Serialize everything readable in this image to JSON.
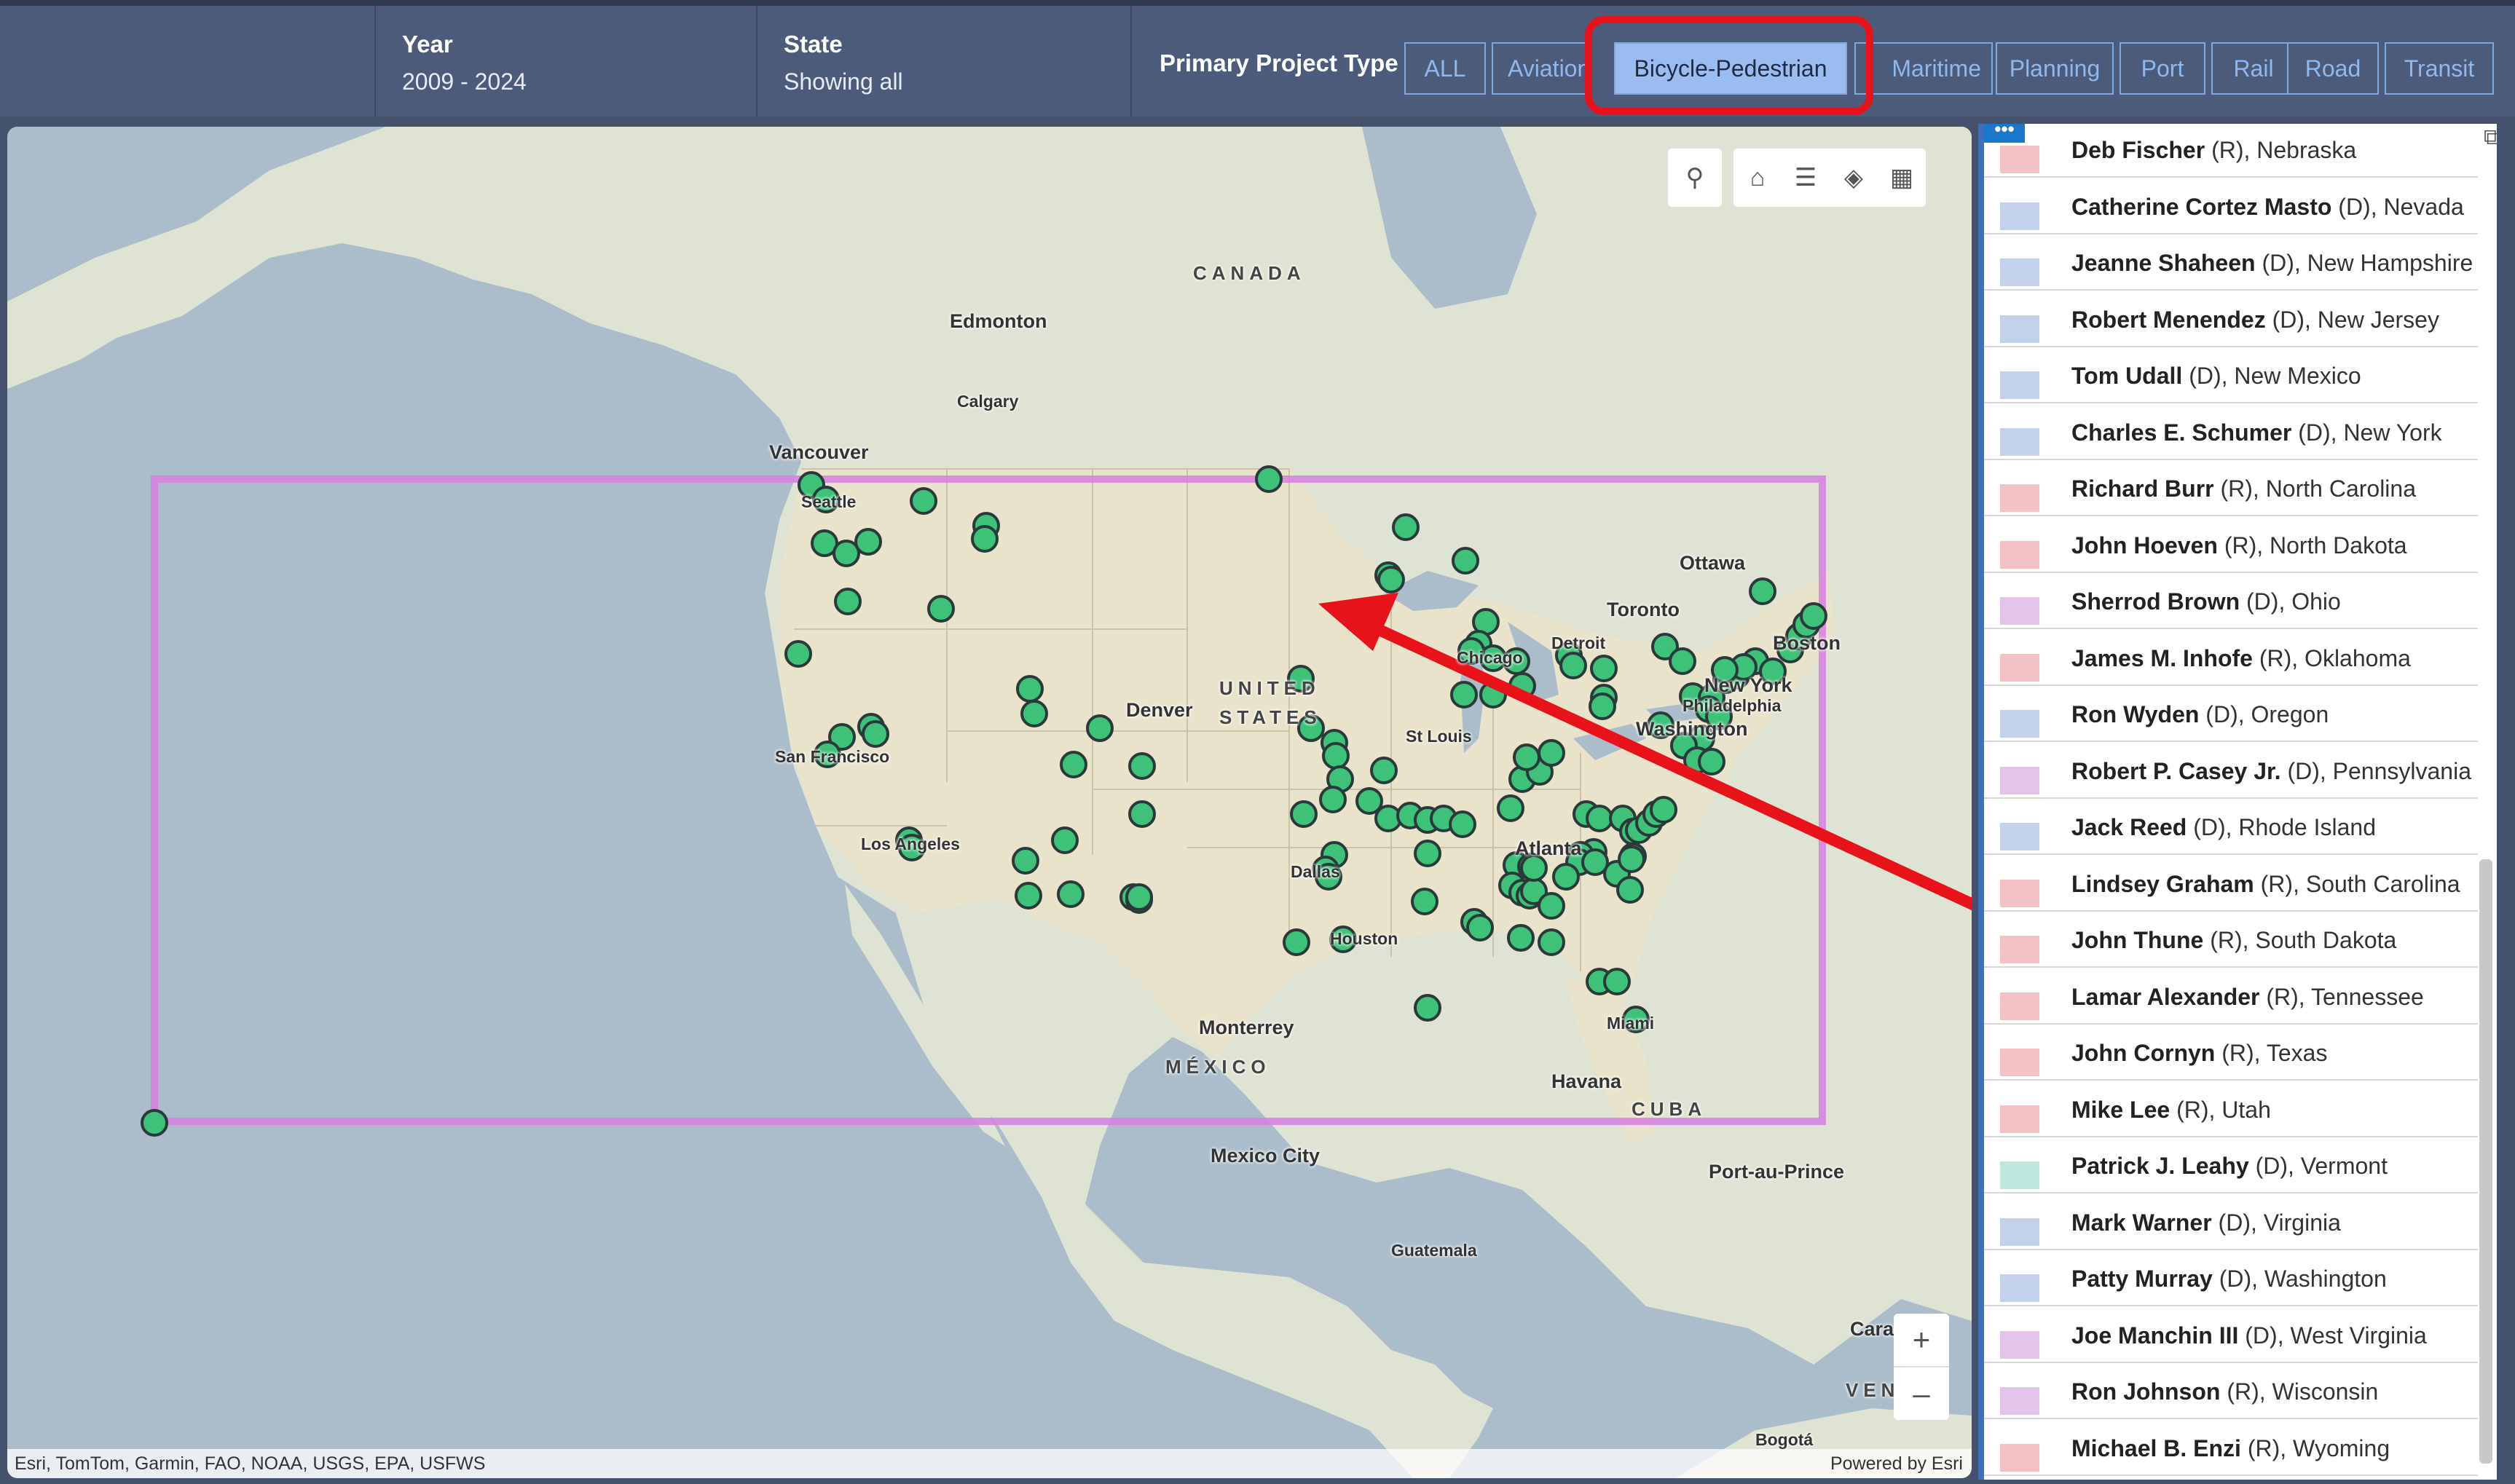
{
  "filters": {
    "year_label": "Year",
    "year_value": "2009 - 2024",
    "state_label": "State",
    "state_value": "Showing all",
    "ptype_label": "Primary Project Type"
  },
  "project_types": [
    "ALL",
    "Aviation",
    "Bicycle-Pedestrian",
    "Maritime",
    "Planning",
    "Port",
    "Rail",
    "Road",
    "Transit"
  ],
  "active_type": "Bicycle-Pedestrian",
  "map": {
    "labels": {
      "canada": "CANADA",
      "edmonton": "Edmonton",
      "calgary": "Calgary",
      "vancouver": "Vancouver",
      "seattle": "Seattle",
      "ottawa": "Ottawa",
      "toronto": "Toronto",
      "detroit": "Detroit",
      "chicago": "Chicago",
      "boston": "Boston",
      "new_york": "New York",
      "philadelphia": "Philadelphia",
      "washington": "Washington",
      "united": "UNITED",
      "states": "STATES",
      "denver": "Denver",
      "st_louis": "St Louis",
      "san_francisco": "San Francisco",
      "los_angeles": "Los Angeles",
      "atlanta": "Atlanta",
      "dallas": "Dallas",
      "houston": "Houston",
      "miami": "Miami",
      "monterrey": "Monterrey",
      "mexico": "MÉXICO",
      "havana": "Havana",
      "cuba": "CUBA",
      "mexico_city": "Mexico City",
      "port_au_prince": "Port-au-Prince",
      "guatemala": "Guatemala",
      "cara": "Cara",
      "vene": "VENE",
      "bogota": "Bogotá"
    },
    "attribution": "Esri, TomTom, Garmin, FAO, NOAA, USGS, EPA, USFWS",
    "powered_by": "Powered by Esri",
    "colors": {
      "marker": "#3ec27a",
      "extent": "#d77fe0",
      "arrow": "#e8121a"
    }
  },
  "senators": [
    {
      "name": "Deb Fischer",
      "info": " (R), Nebraska",
      "party": "R"
    },
    {
      "name": "Catherine Cortez Masto",
      "info": " (D), Nevada",
      "party": "D"
    },
    {
      "name": "Jeanne Shaheen",
      "info": " (D), New Hampshire",
      "party": "D"
    },
    {
      "name": "Robert Menendez",
      "info": " (D), New Jersey",
      "party": "D"
    },
    {
      "name": "Tom Udall",
      "info": " (D), New Mexico",
      "party": "D"
    },
    {
      "name": "Charles E. Schumer",
      "info": " (D), New York",
      "party": "D"
    },
    {
      "name": "Richard Burr",
      "info": " (R), North Carolina",
      "party": "R"
    },
    {
      "name": "John Hoeven",
      "info": " (R), North Dakota",
      "party": "R"
    },
    {
      "name": "Sherrod Brown",
      "info": " (D), Ohio",
      "party": "S"
    },
    {
      "name": "James M. Inhofe",
      "info": " (R), Oklahoma",
      "party": "R"
    },
    {
      "name": "Ron Wyden",
      "info": " (D), Oregon",
      "party": "D"
    },
    {
      "name": "Robert P. Casey Jr.",
      "info": " (D), Pennsylvania",
      "party": "S"
    },
    {
      "name": "Jack Reed",
      "info": " (D), Rhode Island",
      "party": "D"
    },
    {
      "name": "Lindsey Graham",
      "info": " (R), South Carolina",
      "party": "R"
    },
    {
      "name": "John Thune",
      "info": " (R), South Dakota",
      "party": "R"
    },
    {
      "name": "Lamar Alexander",
      "info": " (R), Tennessee",
      "party": "R"
    },
    {
      "name": "John Cornyn",
      "info": " (R), Texas",
      "party": "R"
    },
    {
      "name": "Mike Lee",
      "info": " (R), Utah",
      "party": "R"
    },
    {
      "name": "Patrick J. Leahy",
      "info": " (D), Vermont",
      "party": "G"
    },
    {
      "name": "Mark Warner",
      "info": " (D), Virginia",
      "party": "D"
    },
    {
      "name": "Patty Murray",
      "info": " (D), Washington",
      "party": "D"
    },
    {
      "name": "Joe Manchin III",
      "info": " (D), West Virginia",
      "party": "S"
    },
    {
      "name": "Ron Johnson",
      "info": " (R), Wisconsin",
      "party": "S"
    },
    {
      "name": "Michael B. Enzi",
      "info": " (R), Wyoming",
      "party": "R"
    }
  ],
  "swatch_colors": {
    "R": "#f2c2c4",
    "D": "#c3d2ea",
    "S": "#e4c5ea",
    "G": "#bfe6dc"
  }
}
